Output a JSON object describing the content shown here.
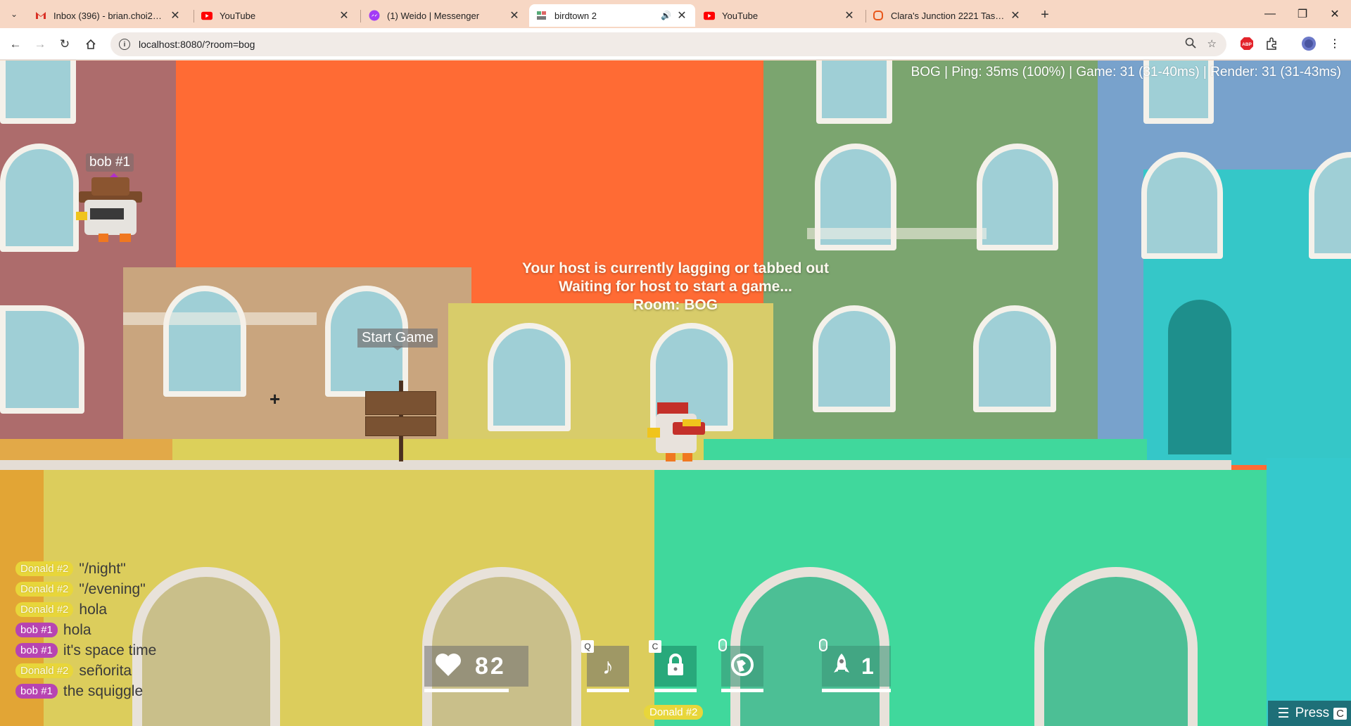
{
  "browser": {
    "tabs": [
      {
        "title": "Inbox (396) - brian.choi222@gmail.com",
        "icon": "gmail-icon"
      },
      {
        "title": "YouTube",
        "icon": "youtube-icon"
      },
      {
        "title": "(1) Weido | Messenger",
        "icon": "messenger-icon"
      },
      {
        "title": "birdtown 2",
        "icon": "birdtown-icon",
        "active": true
      },
      {
        "title": "YouTube",
        "icon": "youtube-icon"
      },
      {
        "title": "Clara's Junction 2221 Tasman Dr",
        "icon": "clara-icon"
      }
    ],
    "url": "localhost:8080/?room=bog"
  },
  "game": {
    "stats": "BOG | Ping: 35ms (100%) | Game: 31 (31-40ms) | Render: 31 (31-43ms)",
    "host_message": {
      "line1": "Your host is currently lagging or tabbed out",
      "line2": "Waiting for host to start a game...",
      "line3": "Room: BOG"
    },
    "player_names": {
      "bob": "bob #1",
      "self": "Donald #2"
    },
    "start_game_label": "Start Game",
    "chat": [
      {
        "user": "Donald #2",
        "team": "donald",
        "message": "\"/night\""
      },
      {
        "user": "Donald #2",
        "team": "donald",
        "message": "\"/evening\""
      },
      {
        "user": "Donald #2",
        "team": "donald",
        "message": "hola"
      },
      {
        "user": "bob #1",
        "team": "bob",
        "message": "hola"
      },
      {
        "user": "bob #1",
        "team": "bob",
        "message": "it's space time"
      },
      {
        "user": "Donald #2",
        "team": "donald",
        "message": "señorita"
      },
      {
        "user": "bob #1",
        "team": "bob",
        "message": "the squiggle"
      }
    ],
    "hud": {
      "health": "82",
      "music_key": "Q",
      "lock_key": "C",
      "rocket_count": "1"
    },
    "press_label": "Press",
    "press_key": "C"
  }
}
